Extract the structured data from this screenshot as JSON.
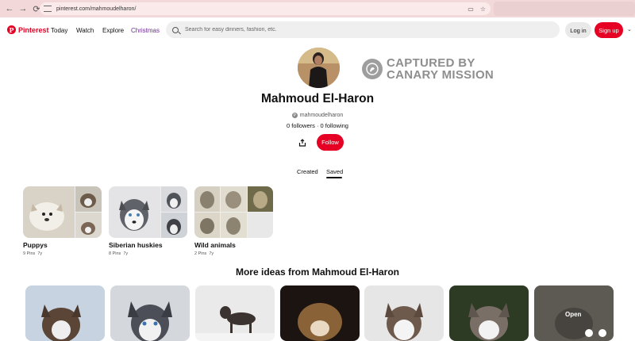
{
  "browser": {
    "url": "pinterest.com/mahmoudelharon/",
    "icons": [
      "back-icon",
      "forward-icon",
      "reload-icon",
      "site-info-icon",
      "cast-icon",
      "bookmark-star-icon"
    ]
  },
  "header": {
    "brand": "Pinterest",
    "nav": [
      "Today",
      "Watch",
      "Explore",
      "Christmas"
    ],
    "search_placeholder": "Search for easy dinners, fashion, etc.",
    "login_label": "Log in",
    "signup_label": "Sign up",
    "colors": {
      "brand": "#e60023",
      "christmas": "#6b2c91"
    }
  },
  "watermark": {
    "line1": "CAPTURED BY",
    "line2": "CANARY MISSION"
  },
  "profile": {
    "name": "Mahmoud El-Haron",
    "handle": "mahmoudelharon",
    "followers": "0 followers · 0 following",
    "follow_label": "Follow"
  },
  "tabs": {
    "created": "Created",
    "saved": "Saved",
    "active": "Saved"
  },
  "boards": [
    {
      "title": "Puppys",
      "pins": "9 Pins",
      "age": "7y"
    },
    {
      "title": "Siberian huskies",
      "pins": "8 Pins",
      "age": "7y"
    },
    {
      "title": "Wild animals",
      "pins": "2 Pins",
      "age": "7y"
    }
  ],
  "more_ideas": "More ideas from Mahmoud El-Haron",
  "pins": {
    "open_label": "Open"
  }
}
